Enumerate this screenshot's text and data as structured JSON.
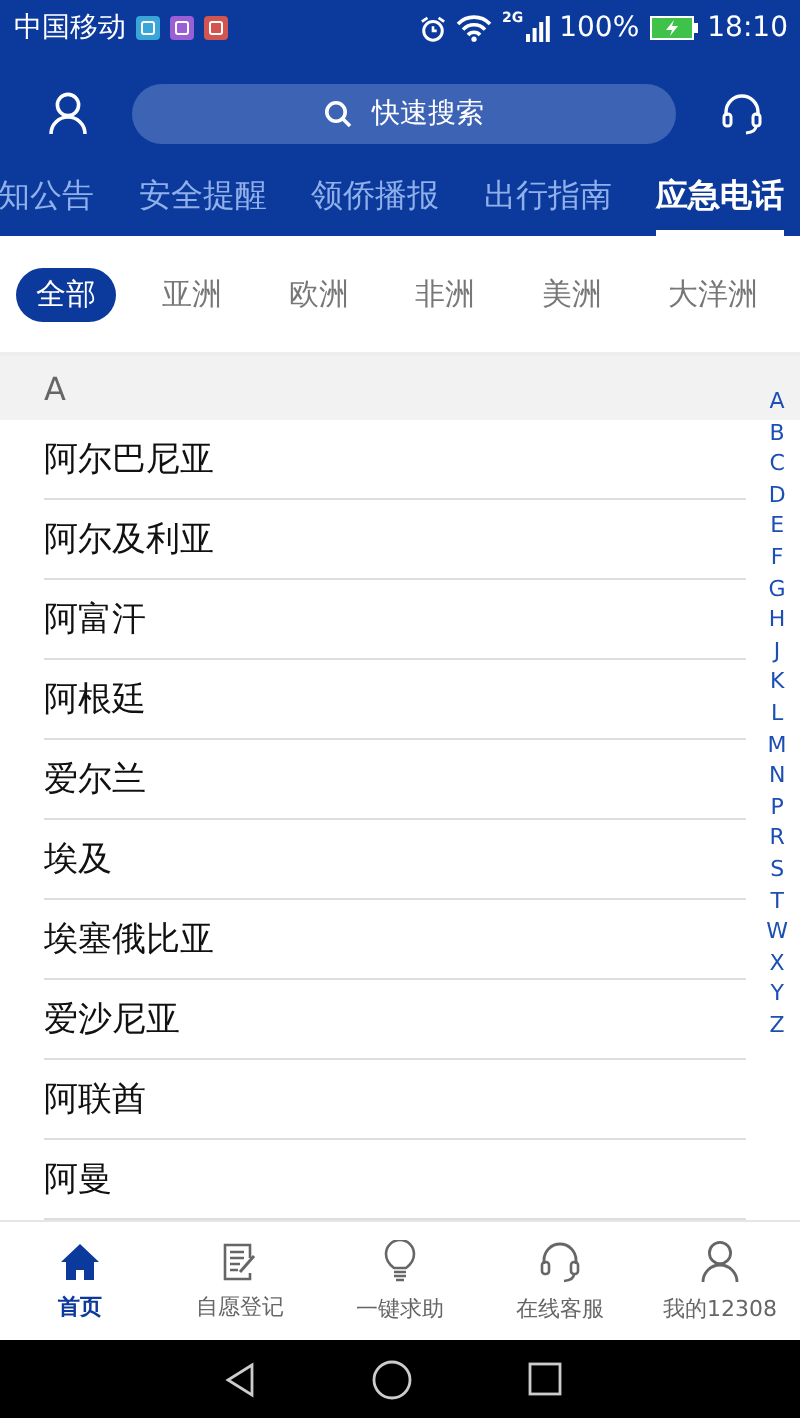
{
  "status_bar": {
    "carrier": "中国移动",
    "network": "2G",
    "battery": "100%",
    "time": "18:10"
  },
  "header": {
    "search": {
      "placeholder": "快速搜索"
    }
  },
  "tabs": [
    {
      "label": "知公告",
      "selected": false
    },
    {
      "label": "安全提醒",
      "selected": false
    },
    {
      "label": "领侨播报",
      "selected": false
    },
    {
      "label": "出行指南",
      "selected": false
    },
    {
      "label": "应急电话",
      "selected": true
    }
  ],
  "regions": [
    {
      "label": "全部",
      "selected": true
    },
    {
      "label": "亚洲",
      "selected": false
    },
    {
      "label": "欧洲",
      "selected": false
    },
    {
      "label": "非洲",
      "selected": false
    },
    {
      "label": "美洲",
      "selected": false
    },
    {
      "label": "大洋洲",
      "selected": false
    }
  ],
  "section": "A",
  "countries": [
    "阿尔巴尼亚",
    "阿尔及利亚",
    "阿富汗",
    "阿根廷",
    "爱尔兰",
    "埃及",
    "埃塞俄比亚",
    "爱沙尼亚",
    "阿联酋",
    "阿曼"
  ],
  "index_letters": [
    "A",
    "B",
    "C",
    "D",
    "E",
    "F",
    "G",
    "H",
    "J",
    "K",
    "L",
    "M",
    "N",
    "P",
    "R",
    "S",
    "T",
    "W",
    "X",
    "Y",
    "Z"
  ],
  "bottom_nav": [
    {
      "label": "首页",
      "kind": "home",
      "selected": true
    },
    {
      "label": "自愿登记",
      "kind": "register",
      "selected": false
    },
    {
      "label": "一键求助",
      "kind": "help",
      "selected": false
    },
    {
      "label": "在线客服",
      "kind": "service",
      "selected": false
    },
    {
      "label": "我的12308",
      "kind": "profile",
      "selected": false
    }
  ]
}
